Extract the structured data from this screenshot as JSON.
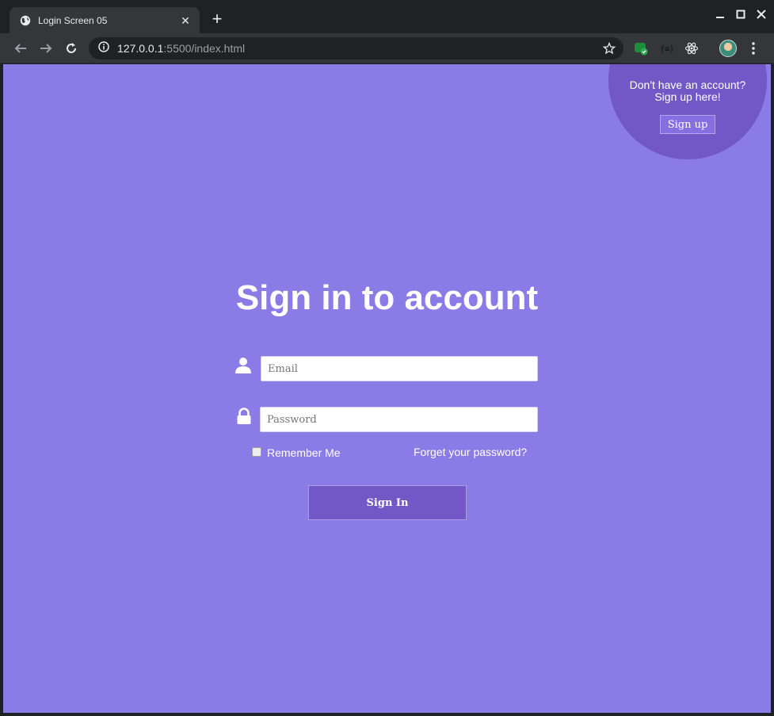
{
  "browser": {
    "tab_title": "Login Screen 05",
    "tab_close": "✕",
    "new_tab": "+",
    "url_host": "127.0.0.1",
    "url_rest": ":5500/index.html"
  },
  "signup": {
    "prompt_line1": "Don't have an account?",
    "prompt_line2": "Sign up here!",
    "button_label": "Sign up"
  },
  "login": {
    "heading": "Sign in to account",
    "email_placeholder": "Email",
    "password_placeholder": "Password",
    "remember_label": "Remember Me",
    "forgot_label": "Forget your password?",
    "signin_label": "Sign In"
  },
  "icons": {
    "user": "user-icon",
    "lock": "lock-icon"
  },
  "colors": {
    "page_bg": "#8b7be6",
    "accent": "#7258c6",
    "chrome_dark": "#202124",
    "chrome_toolbar": "#35363a"
  }
}
